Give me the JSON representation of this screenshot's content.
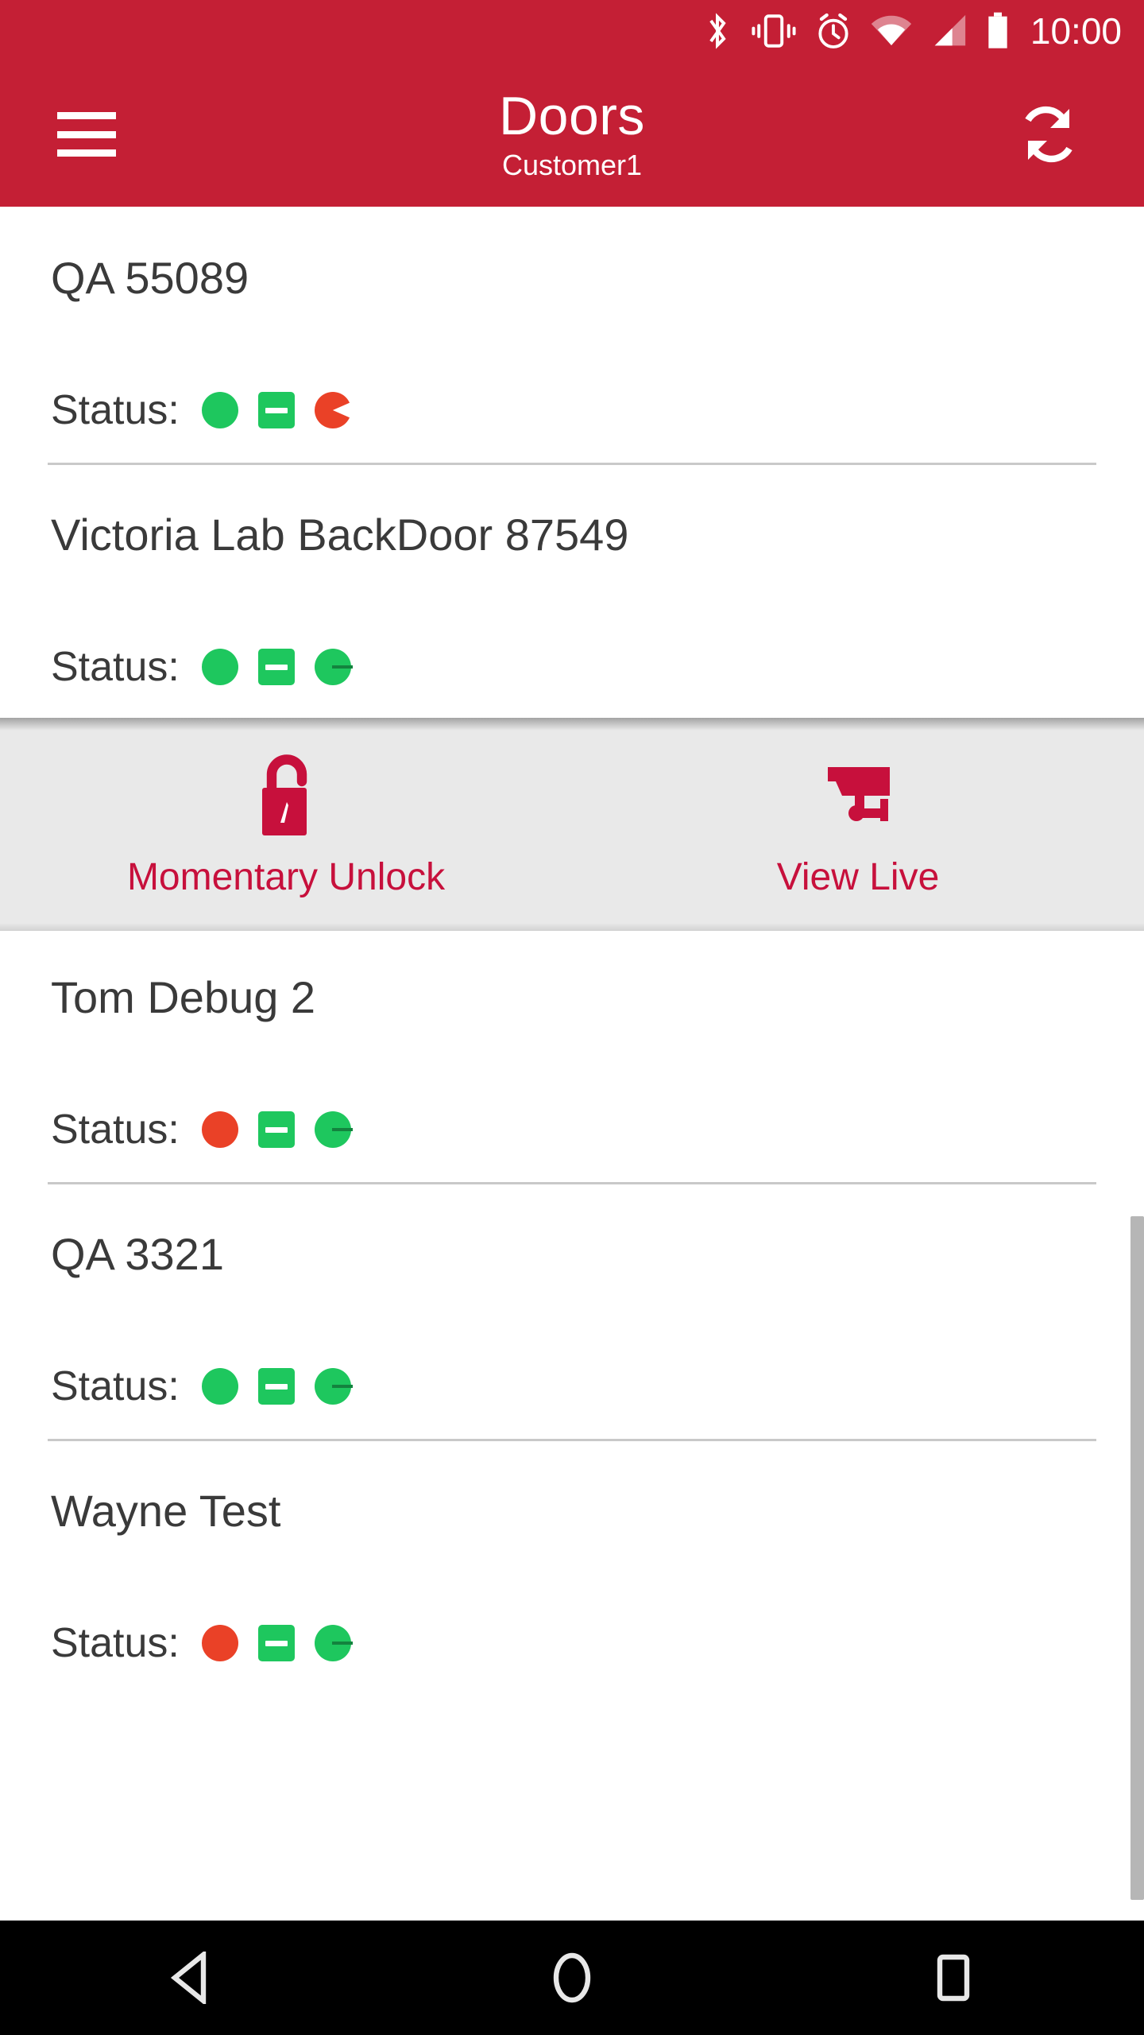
{
  "statusbar": {
    "time": "10:00",
    "icons": [
      "bluetooth-icon",
      "vibrate-icon",
      "alarm-icon",
      "wifi-icon",
      "cell-signal-icon",
      "battery-icon"
    ]
  },
  "appbar": {
    "menu_icon": "hamburger-menu-icon",
    "title": "Doors",
    "subtitle": "Customer1",
    "refresh_icon": "refresh-sync-icon"
  },
  "list": {
    "status_label": "Status:",
    "items": [
      {
        "name": "QA 55089",
        "badges": [
          "green-dot",
          "green-minus-square",
          "red-pacman"
        ],
        "expanded": false
      },
      {
        "name": "Victoria Lab BackDoor 87549",
        "badges": [
          "green-dot",
          "green-minus-square",
          "green-pie"
        ],
        "expanded": true
      },
      {
        "name": "Tom Debug 2",
        "badges": [
          "red-dot",
          "green-minus-square",
          "green-pie"
        ],
        "expanded": false
      },
      {
        "name": "QA 3321",
        "badges": [
          "green-dot",
          "green-minus-square",
          "green-pie"
        ],
        "expanded": false
      },
      {
        "name": "Wayne Test",
        "badges": [
          "red-dot",
          "green-minus-square",
          "green-pie"
        ],
        "expanded": false
      }
    ]
  },
  "action_panel": {
    "unlock_label": "Momentary Unlock",
    "unlock_icon": "open-padlock-icon",
    "viewlive_label": "View Live",
    "viewlive_icon": "security-camera-icon"
  },
  "navbar": {
    "back": "back-triangle-icon",
    "home": "home-circle-icon",
    "recents": "recents-square-icon"
  },
  "colors": {
    "brand_red": "#C41F35",
    "action_red": "#C7103C",
    "status_green": "#1EC75E",
    "status_red": "#EA4127",
    "panel_bg": "#E9E9E9",
    "divider": "#c9c9c9",
    "text": "#3a3a3a"
  }
}
